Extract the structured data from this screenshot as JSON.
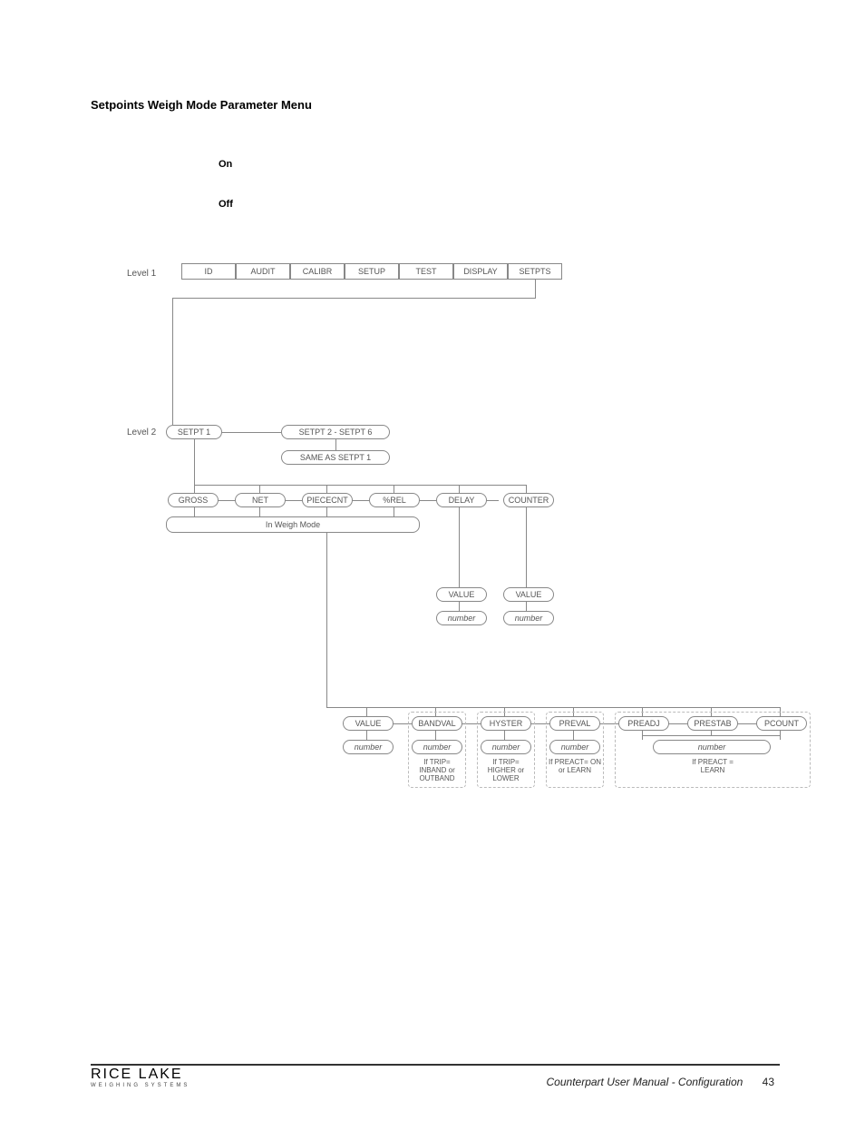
{
  "heading": "Setpoints Weigh Mode Parameter Menu",
  "toggle": {
    "on": "On",
    "off": "Off"
  },
  "levels": {
    "l1": "Level 1",
    "l2": "Level 2"
  },
  "top_row": [
    "ID",
    "AUDIT",
    "CALIBR",
    "SETUP",
    "TEST",
    "DISPLAY",
    "SETPTS"
  ],
  "l2": {
    "setpt1": "SETPT 1",
    "setpt26": "SETPT 2 - SETPT 6",
    "same": "SAME AS SETPT 1"
  },
  "modes": {
    "gross": "GROSS",
    "net": "NET",
    "piececnt": "PIECECNT",
    "prel": "%REL",
    "delay": "DELAY",
    "counter": "COUNTER",
    "inweigh": "In Weigh Mode"
  },
  "vals": {
    "value": "VALUE",
    "number": "number",
    "bandval": "BANDVAL",
    "hyster": "HYSTER",
    "preval": "PREVAL",
    "preadj": "PREADJ",
    "prestab": "PRESTAB",
    "pcount": "PCOUNT"
  },
  "conds": {
    "trip_band": "If TRIP= INBAND or OUTBAND",
    "trip_hl": "If TRIP= HIGHER or LOWER",
    "preact_onlearn": "If PREACT= ON or LEARN",
    "preact_learn": "If PREACT = LEARN"
  },
  "footer": {
    "logo_main": "RICE LAKE",
    "logo_sub": "WEIGHING SYSTEMS",
    "doc": "Counterpart User Manual - Configuration",
    "page": "43"
  },
  "chart_data": {
    "type": "tree",
    "title": "Setpoints Weigh Mode Parameter Menu",
    "notes": [
      "On",
      "Off"
    ],
    "root": {
      "level": 1,
      "items": [
        "ID",
        "AUDIT",
        "CALIBR",
        "SETUP",
        "TEST",
        "DISPLAY",
        "SETPTS"
      ],
      "children_of": "SETPTS",
      "children": {
        "level": 2,
        "items": [
          {
            "name": "SETPT 1"
          },
          {
            "name": "SETPT 2 - SETPT 6",
            "note": "SAME AS SETPT 1"
          }
        ],
        "children_of": "SETPT 1",
        "children": [
          {
            "group_label": "In Weigh Mode",
            "items": [
              {
                "name": "GROSS",
                "children": [
                  {
                    "name": "VALUE",
                    "value": "number"
                  },
                  {
                    "name": "BANDVAL",
                    "value": "number",
                    "condition": "If TRIP= INBAND or OUTBAND"
                  },
                  {
                    "name": "HYSTER",
                    "value": "number",
                    "condition": "If TRIP= HIGHER or LOWER"
                  },
                  {
                    "name": "PREVAL",
                    "value": "number",
                    "condition": "If PREACT= ON or LEARN"
                  },
                  {
                    "condition": "If PREACT = LEARN",
                    "value": "number",
                    "items": [
                      "PREADJ",
                      "PRESTAB",
                      "PCOUNT"
                    ]
                  }
                ]
              },
              {
                "name": "NET"
              },
              {
                "name": "PIECECNT"
              },
              {
                "name": "%REL"
              }
            ]
          },
          {
            "name": "DELAY",
            "children": [
              {
                "name": "VALUE",
                "value": "number"
              }
            ]
          },
          {
            "name": "COUNTER",
            "children": [
              {
                "name": "VALUE",
                "value": "number"
              }
            ]
          }
        ]
      }
    }
  }
}
